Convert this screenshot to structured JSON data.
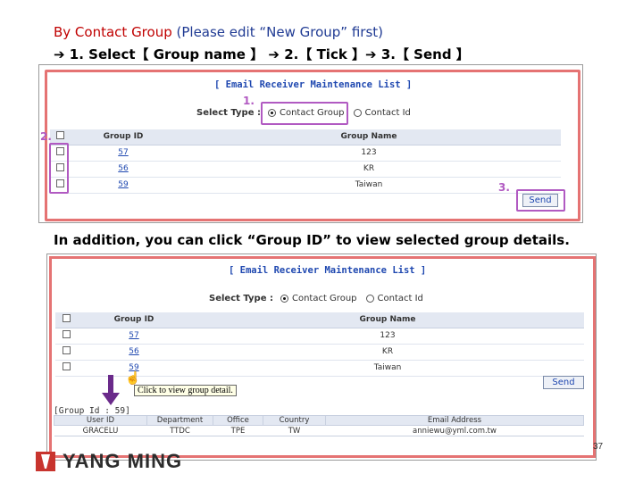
{
  "heading": {
    "line1_red": "By Contact Group",
    "line1_blue": " (Please edit “New Group” first)",
    "line2": "➔ 1. Select【 Group name 】 ➔ 2.【 Tick 】➔ 3.【 Send 】",
    "line3": "In addition, you can click “Group ID” to view selected group details."
  },
  "panel1": {
    "title": "[ Email Receiver Maintenance List ]",
    "select_type_label": "Select Type :",
    "option_group": "Contact Group",
    "option_id": "Contact Id",
    "col_group_id": "Group ID",
    "col_group_name": "Group Name",
    "rows": [
      {
        "id": "57",
        "name": "123"
      },
      {
        "id": "56",
        "name": "KR"
      },
      {
        "id": "59",
        "name": "Taiwan"
      }
    ],
    "send": "Send",
    "step1": "1.",
    "step2": "2.",
    "step3": "3."
  },
  "panel2": {
    "title": "[ Email Receiver Maintenance List ]",
    "select_type_label": "Select Type :",
    "option_group": "Contact Group",
    "option_id": "Contact Id",
    "col_group_id": "Group ID",
    "col_group_name": "Group Name",
    "rows": [
      {
        "id": "57",
        "name": "123"
      },
      {
        "id": "56",
        "name": "KR"
      },
      {
        "id": "59",
        "name": "Taiwan"
      }
    ],
    "send": "Send",
    "tooltip": "Click to view group detail.",
    "detail_title": "[Group Id : 59]",
    "detail_headers": [
      "User ID",
      "Department",
      "Office",
      "Country",
      "Email Address"
    ],
    "detail_row": [
      "GRACELU",
      "TTDC",
      "TPE",
      "TW",
      "anniewu@yml.com.tw"
    ]
  },
  "page_number": "37",
  "logo_text": "YANG MING"
}
